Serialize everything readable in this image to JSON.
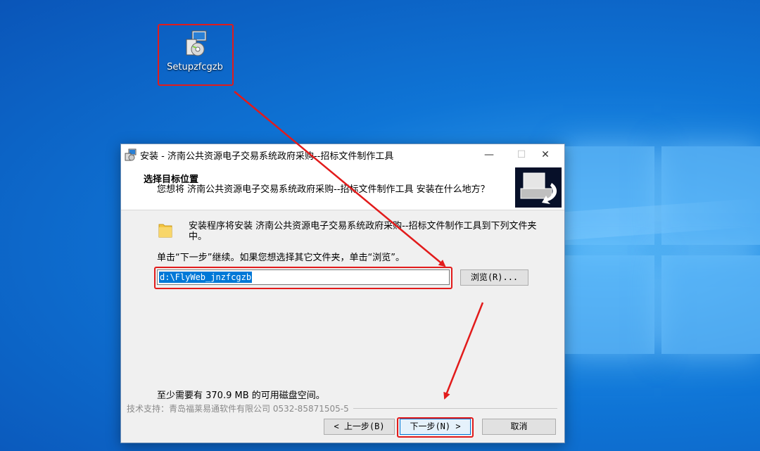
{
  "desktop": {
    "icon_label": "Setupzfcgzb"
  },
  "window": {
    "title": "安装 - 济南公共资源电子交易系统政府采购--招标文件制作工具",
    "minimize": "—",
    "maximize": "☐",
    "close": "✕",
    "header": {
      "title": "选择目标位置",
      "subtitle": "您想将 济南公共资源电子交易系统政府采购--招标文件制作工具 安装在什么地方？"
    },
    "content": {
      "description": "安装程序将安装 济南公共资源电子交易系统政府采购--招标文件制作工具到下列文件夹中。",
      "instruction": "单击“下一步”继续。如果您想选择其它文件夹，单击“浏览”。",
      "path_value": "d:\\FlyWeb_jnzfcgzb",
      "browse_label": "浏览(R)...",
      "space_required": "至少需要有 370.9 MB 的可用磁盘空间。"
    },
    "support_text": "技术支持：青岛福莱易通软件有限公司 0532-85871505-5",
    "buttons": {
      "back": "< 上一步(B)",
      "next": "下一步(N) >",
      "cancel": "取消"
    }
  },
  "colors": {
    "annotation_red": "#e21b1b",
    "selection_blue": "#0078d7"
  }
}
